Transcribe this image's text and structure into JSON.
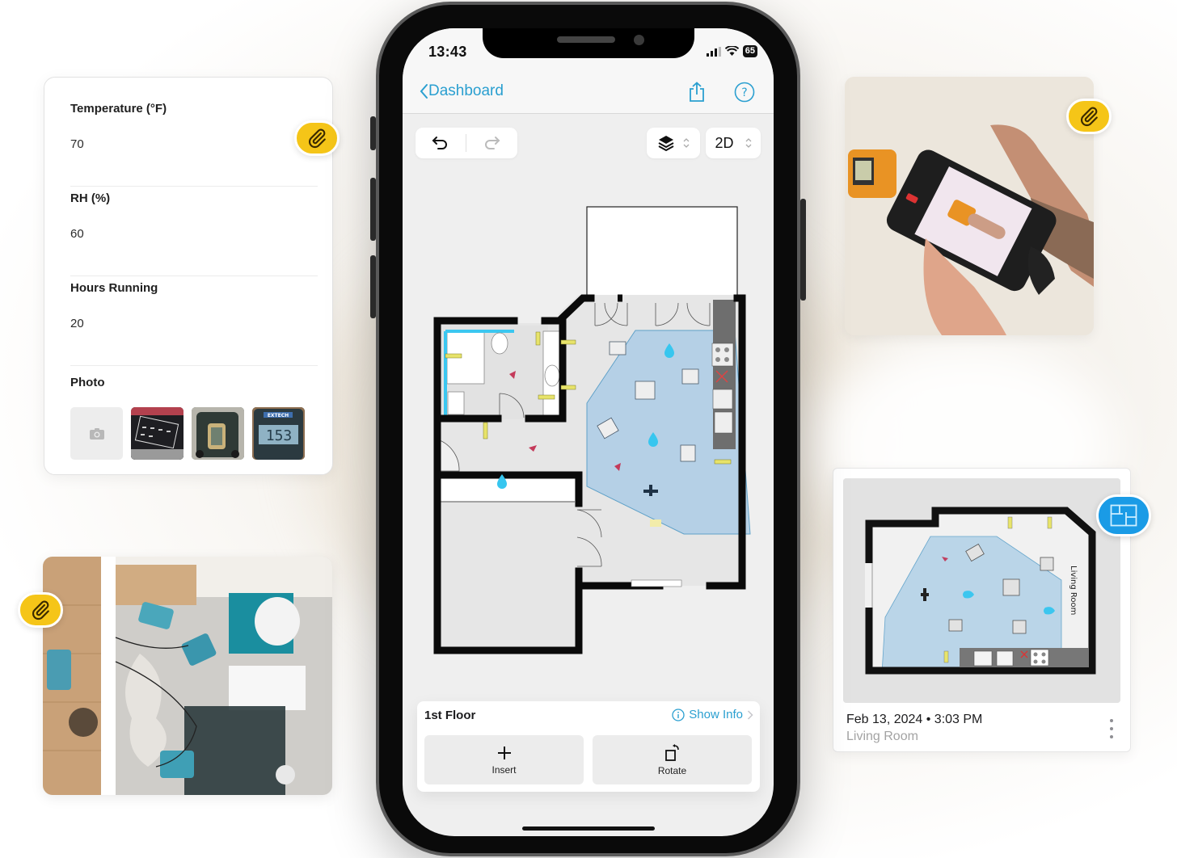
{
  "form_card": {
    "fields": [
      {
        "label": "Temperature (°F)",
        "value": "70"
      },
      {
        "label": "RH (%)",
        "value": "60"
      },
      {
        "label": "Hours Running",
        "value": "20"
      }
    ],
    "photo_label": "Photo",
    "photo_add_icon": "camera-icon",
    "photo_count": 3
  },
  "badges": {
    "attachment_icon": "paperclip-icon",
    "floorplan_icon": "floorplan-icon",
    "attachment_color": "#f5c518",
    "floorplan_color": "#1a9be6"
  },
  "phone": {
    "status_bar": {
      "time": "13:43",
      "battery": "65"
    },
    "nav": {
      "back_label": "Dashboard",
      "share_icon": "share-icon",
      "help_icon": "help-icon"
    },
    "toolbar": {
      "undo_icon": "undo-icon",
      "redo_icon": "redo-icon",
      "layers_icon": "layers-icon",
      "view_mode": "2D"
    },
    "bottom_panel": {
      "floor_name": "1st Floor",
      "show_info_label": "Show Info",
      "actions": [
        {
          "label": "Insert",
          "icon": "plus-icon"
        },
        {
          "label": "Rotate",
          "icon": "rotate-icon"
        }
      ]
    },
    "accent_color": "#2a9fd0"
  },
  "plan_card": {
    "date": "Feb 13, 2024 • 3:03 PM",
    "room": "Living Room",
    "thumb_room_label": "Living Room"
  }
}
